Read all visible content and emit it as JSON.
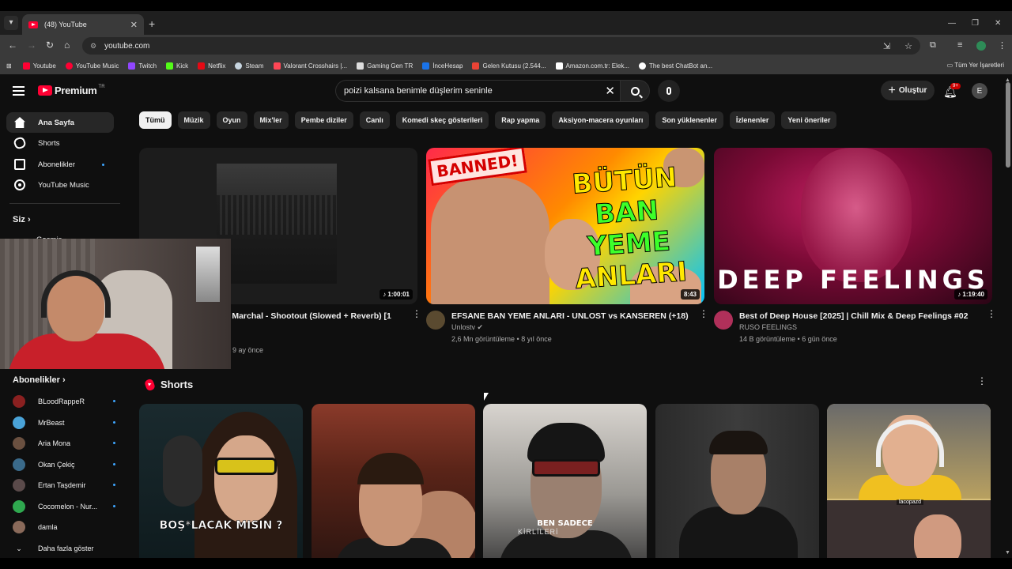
{
  "browser": {
    "tab_title": "(48) YouTube",
    "url": "youtube.com",
    "bookmarks": [
      {
        "label": "Youtube",
        "color": "#ff0033"
      },
      {
        "label": "YouTube Music",
        "color": "#ff0033"
      },
      {
        "label": "Twitch",
        "color": "#9146ff"
      },
      {
        "label": "Kick",
        "color": "#53fc18"
      },
      {
        "label": "Netflix",
        "color": "#e50914"
      },
      {
        "label": "Steam",
        "color": "#c7d5e0"
      },
      {
        "label": "Valorant Crosshairs |...",
        "color": "#ff4655"
      },
      {
        "label": "Gaming Gen TR",
        "color": "#dddddd"
      },
      {
        "label": "İnceHesap",
        "color": "#1a73e8"
      },
      {
        "label": "Gelen Kutusu (2.544...",
        "color": "#ea4335"
      },
      {
        "label": "Amazon.com.tr: Elek...",
        "color": "#ffffff"
      },
      {
        "label": "The best ChatBot an...",
        "color": "#ffffff"
      }
    ],
    "bookmarks_all": "Tüm Yer İşaretleri"
  },
  "header": {
    "logo": "Premium",
    "country": "TR",
    "search_query": "poizi kalsana benimle düşlerim seninle",
    "create_label": "Oluştur",
    "notif_count": "9+",
    "avatar_letter": "E"
  },
  "sidebar": {
    "items": [
      {
        "label": "Ana Sayfa",
        "icon": "home-icon"
      },
      {
        "label": "Shorts",
        "icon": "shorts-icon"
      },
      {
        "label": "Abonelikler",
        "icon": "subscriptions-icon"
      },
      {
        "label": "YouTube Music",
        "icon": "youtube-music-icon"
      }
    ],
    "you_label": "Siz",
    "partial_label": "Geçmiş",
    "subs_heading": "Abonelikler",
    "subscriptions": [
      {
        "name": "BLoodRappeR",
        "color": "#8a2020"
      },
      {
        "name": "MrBeast",
        "color": "#4aa3d8"
      },
      {
        "name": "Aria Mona",
        "color": "#6a5040"
      },
      {
        "name": "Okan Çekiç",
        "color": "#3a6a8a"
      },
      {
        "name": "Ertan Taşdemir",
        "color": "#5a4a4a"
      },
      {
        "name": "Cocomelon - Nur...",
        "color": "#2fa84f"
      },
      {
        "name": "damla",
        "color": "#8a6a5a"
      }
    ],
    "show_more": "Daha fazla göster"
  },
  "chips": [
    "Tümü",
    "Müzik",
    "Oyun",
    "Mix'ler",
    "Pembe diziler",
    "Canlı",
    "Komedi skeç gösterileri",
    "Rap yapma",
    "Aksiyon-macera oyunları",
    "Son yüklenenler",
    "İzlenenler",
    "Yeni öneriler"
  ],
  "videos": [
    {
      "title": "n Marchal - Shootout (Slowed + Reverb) [1",
      "channel": "",
      "stats": "9 ay önce",
      "duration": "1:00:01",
      "avatar_color": "#333333"
    },
    {
      "title": "EFSANE BAN YEME ANLARI - UNLOST vs KANSEREN (+18)",
      "channel": "Unlostv",
      "stats": "2,6 Mn görüntüleme • 8 yıl önce",
      "duration": "8:43",
      "avatar_color": "#5a4a30",
      "thumb_banned": "BANNED!",
      "thumb_line1": "BÜTÜN",
      "thumb_line2": "BAN YEME",
      "thumb_line3": "ANLARI"
    },
    {
      "title": "Best of Deep House [2025] | Chill Mix & Deep Feelings #02",
      "channel": "RUSO FEELINGS",
      "stats": "14 B görüntüleme • 6 gün önce",
      "duration": "1:19:40",
      "avatar_color": "#b0305a",
      "thumb_text": "DEEP FEELINGS"
    }
  ],
  "shorts": {
    "heading": "Shorts",
    "items": [
      {
        "caption": "BOŞ*LACAK MISIN ?"
      },
      {
        "caption": ""
      },
      {
        "caption": "BEN SADECE",
        "caption2": "KİRLİLERİ"
      },
      {
        "caption": ""
      },
      {
        "caption": "",
        "tag": "lacopazd"
      }
    ]
  }
}
